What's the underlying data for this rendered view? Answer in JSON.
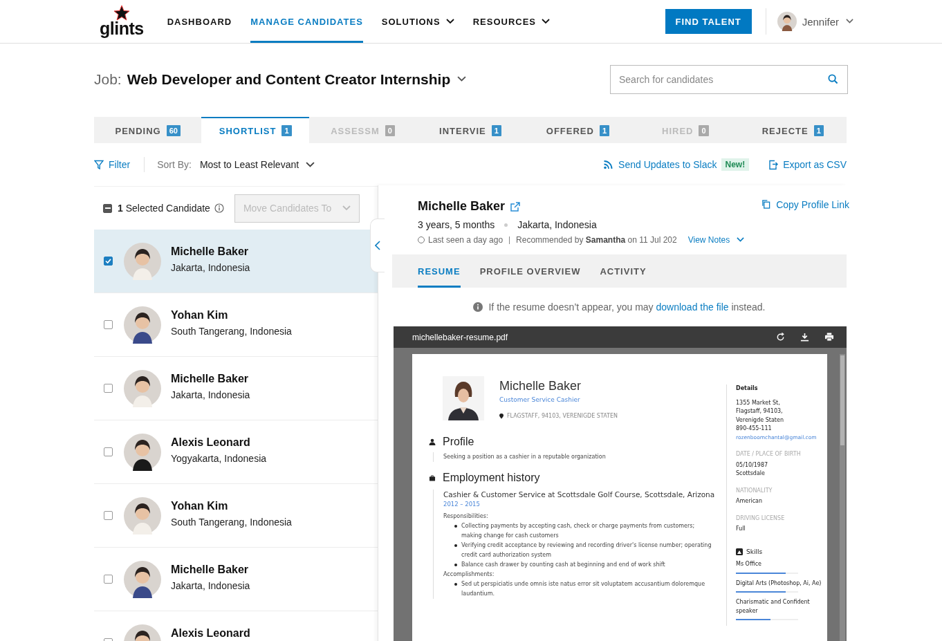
{
  "header": {
    "logo": "glints",
    "nav": [
      {
        "label": "DASHBOARD",
        "selected": false,
        "dropdown": false
      },
      {
        "label": "MANAGE CANDIDATES",
        "selected": true,
        "dropdown": false
      },
      {
        "label": "SOLUTIONS",
        "selected": false,
        "dropdown": true
      },
      {
        "label": "RESOURCES",
        "selected": false,
        "dropdown": true
      }
    ],
    "cta": "FIND TALENT",
    "user": "Jennifer"
  },
  "job": {
    "label": "Job:",
    "title": "Web Developer and Content Creator Internship"
  },
  "search": {
    "placeholder": "Search for candidates"
  },
  "stages": [
    {
      "label": "PENDING",
      "count": "60",
      "selected": false,
      "disabled": false
    },
    {
      "label": "SHORTLIST",
      "count": "1",
      "selected": true,
      "disabled": false
    },
    {
      "label": "ASSESSM",
      "count": "0",
      "selected": false,
      "disabled": true
    },
    {
      "label": "INTERVIE",
      "count": "1",
      "selected": false,
      "disabled": false
    },
    {
      "label": "OFFERED",
      "count": "1",
      "selected": false,
      "disabled": false
    },
    {
      "label": "HIRED",
      "count": "0",
      "selected": false,
      "disabled": true
    },
    {
      "label": "REJECTE",
      "count": "1",
      "selected": false,
      "disabled": false
    }
  ],
  "toolbar": {
    "filter": "Filter",
    "sort_label": "Sort By:",
    "sort_value": "Most to Least Relevant",
    "slack": "Send Updates to Slack",
    "badge": "New!",
    "export": "Export as CSV"
  },
  "selection": {
    "indeterminate": true,
    "summary": "**1** Selected Candidate",
    "move": {
      "label": "Move Candidates To",
      "disabled": true
    }
  },
  "candidates": [
    {
      "name": "Michelle Baker",
      "location": "Jakarta, Indonesia",
      "checked": true,
      "selected": true
    },
    {
      "name": "Yohan Kim",
      "location": "South Tangerang, Indonesia",
      "checked": false,
      "selected": false
    },
    {
      "name": "Michelle Baker",
      "location": "Jakarta, Indonesia",
      "checked": false,
      "selected": false
    },
    {
      "name": "Alexis Leonard",
      "location": "Yogyakarta, Indonesia",
      "checked": false,
      "selected": false
    },
    {
      "name": "Yohan Kim",
      "location": "South Tangerang, Indonesia",
      "checked": false,
      "selected": false
    },
    {
      "name": "Michelle Baker",
      "location": "Jakarta, Indonesia",
      "checked": false,
      "selected": false
    },
    {
      "name": "Alexis Leonard",
      "checked": false,
      "selected": false
    }
  ],
  "profile": {
    "name": "Michelle Baker",
    "experience": "3 years, 5 months",
    "location": "Jakarta, Indonesia",
    "last_seen": "Last seen a day ago",
    "recommended": "Recommended by **Samantha** on 11 Jul 202",
    "view_notes": "View Notes",
    "copy_link": "Copy Profile Link"
  },
  "resume_tabs": [
    {
      "label": "RESUME",
      "selected": true
    },
    {
      "label": "PROFILE OVERVIEW",
      "selected": false
    },
    {
      "label": "ACTIVITY",
      "selected": false
    }
  ],
  "notice": {
    "before": "If the resume doesn’t appear, you may ",
    "link": "download the file",
    "after": " instead."
  },
  "viewer": {
    "filename": "michellebaker-resume.pdf"
  },
  "resume": {
    "name": "Michelle Baker",
    "title": "Customer Service Cashier",
    "location": "FLAGSTAFF, 94103, VERENIGDE STATEN",
    "profile_heading": "Profile",
    "profile_text": "Seeking a position as a cashier in a reputable organization",
    "employment_heading": "Employment history",
    "job_title": "Cashier & Customer Service at Scottsdale Golf Course, Scottsdale, Arizona",
    "dates": "2012 – 2015",
    "responsibilities_label": "Responsibilities:",
    "responsibilities": [
      "Collecting payments by accepting cash, check or charge payments from customers; making change for cash customers",
      "Verifying credit acceptance by reviewing and recording driver's license number; operating credit card authorization system",
      "Balance cash drawer by counting cash at beginning and end of work shift"
    ],
    "accomplishments_label": "Accomplishments:",
    "accomplishments": [
      "Sed ut perspiciatis unde omnis iste natus error sit voluptatem accusantium doloremque laudantium."
    ],
    "details_heading": "Details",
    "address": [
      "1355 Market St,",
      "Flagstaff, 94103,",
      "Verenigde Staten",
      "890-455-111"
    ],
    "email": "rozenboomchantal@gmail.com",
    "facts": [
      {
        "label": "DATE / PLACE OF BIRTH",
        "values": [
          "05/10/1987",
          "Scottsdale"
        ]
      },
      {
        "label": "NATIONALITY",
        "values": [
          "American"
        ]
      },
      {
        "label": "DRIVING LICENSE",
        "values": [
          "Full"
        ]
      }
    ],
    "skills_heading": "Skills",
    "skills": [
      {
        "name": "Ms Office",
        "level": 0.8
      },
      {
        "name": "Digital Arts (Photoshop, Ai, Ae)",
        "level": 0.8
      },
      {
        "name": "Charismatic and Confident speaker",
        "level": 0.55
      }
    ]
  }
}
